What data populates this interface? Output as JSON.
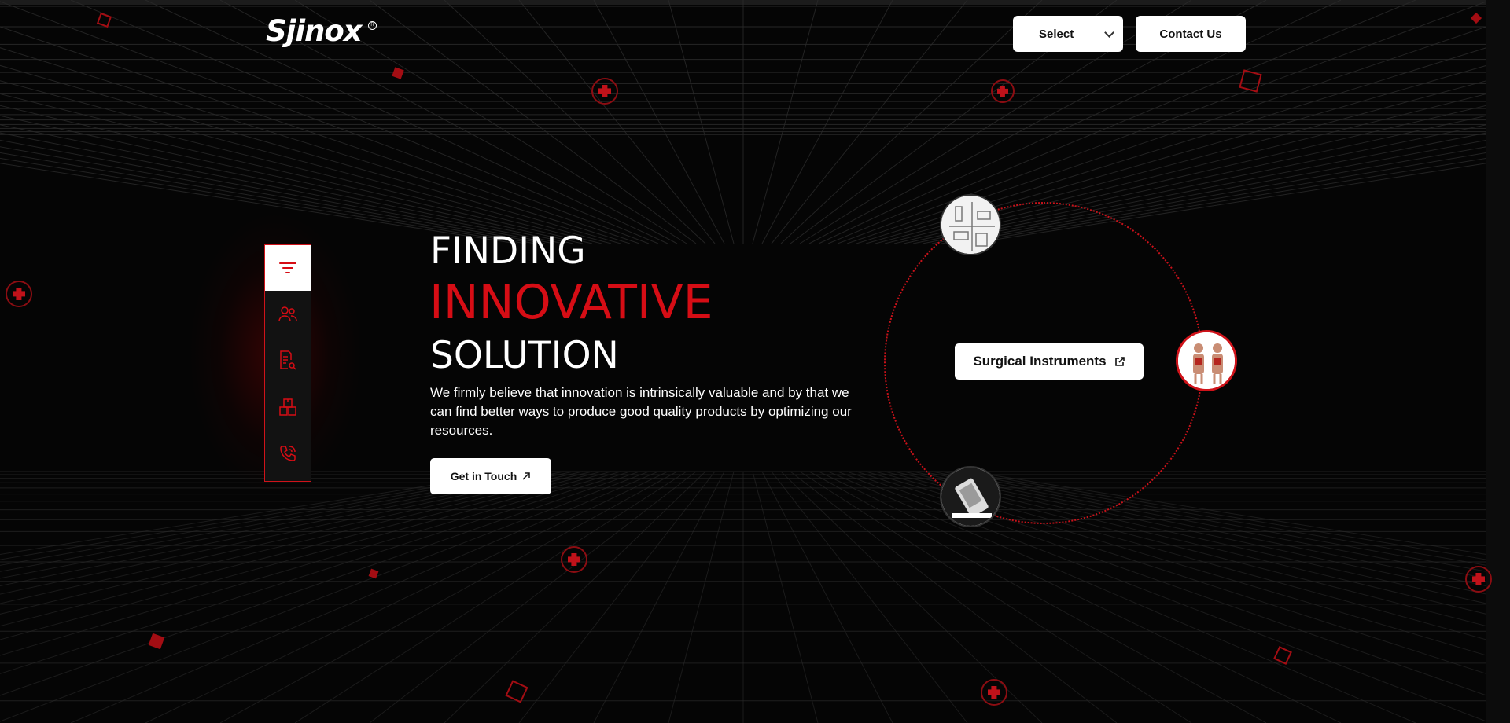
{
  "header": {
    "logo_text": "Sjinox",
    "logo_registered": "R",
    "select_label": "Select",
    "contact_label": "Contact Us"
  },
  "side_nav": {
    "items": [
      {
        "icon": "filter-icon",
        "active": true
      },
      {
        "icon": "users-icon",
        "active": false
      },
      {
        "icon": "document-search-icon",
        "active": false
      },
      {
        "icon": "boxes-icon",
        "active": false
      },
      {
        "icon": "phone-icon",
        "active": false
      }
    ]
  },
  "hero": {
    "line1": "FINDING",
    "line2": "INNOVATIVE",
    "line3": "SOLUTION",
    "description": "We firmly believe that innovation is intrinsically valuable and by that we can find better ways to produce good quality products by optimizing our resources.",
    "cta_label": "Get in Touch",
    "cta_icon": "arrow-up-right-icon"
  },
  "showcase": {
    "category_label": "Surgical Instruments",
    "category_icon": "external-link-icon",
    "thumbnails": [
      {
        "name": "instrument-set-thumbnail"
      },
      {
        "name": "anatomy-model-thumbnail"
      },
      {
        "name": "device-thumbnail"
      }
    ]
  },
  "colors": {
    "accent": "#d60d15",
    "background": "#050505",
    "button": "#ffffff"
  }
}
